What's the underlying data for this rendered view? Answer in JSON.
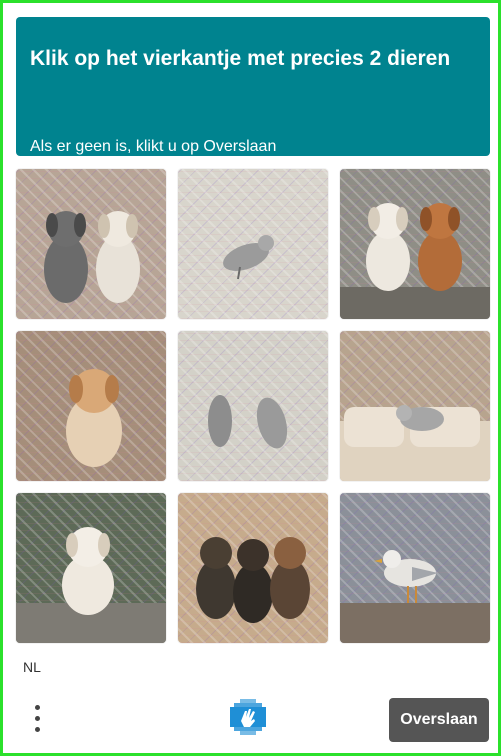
{
  "prompt": {
    "title": "Klik op het vierkantje met precies 2 dieren",
    "subtitle": "Als er geen is, klikt u op Overslaan"
  },
  "grid": {
    "tiles": [
      {
        "icon": "two-puppies-image",
        "bg": "#b7a596"
      },
      {
        "icon": "bird-image",
        "bg": "#d8d5cc"
      },
      {
        "icon": "two-puppies-image",
        "bg": "#8f8e86"
      },
      {
        "icon": "puppy-image",
        "bg": "#a58e7a"
      },
      {
        "icon": "bird-image",
        "bg": "#d3d1c8"
      },
      {
        "icon": "bird-on-sofa-image",
        "bg": "#b7a48e"
      },
      {
        "icon": "puppy-image",
        "bg": "#5d6a57"
      },
      {
        "icon": "three-puppies-image",
        "bg": "#c6ab8c"
      },
      {
        "icon": "seagull-image",
        "bg": "#8b9099"
      }
    ]
  },
  "footer": {
    "language": "NL",
    "skip_label": "Overslaan",
    "menu_icon": "more-vertical-icon",
    "logo_icon": "hcaptcha-logo-icon"
  },
  "colors": {
    "accent": "#00838f",
    "frame": "#2be12b",
    "button": "#555555"
  }
}
